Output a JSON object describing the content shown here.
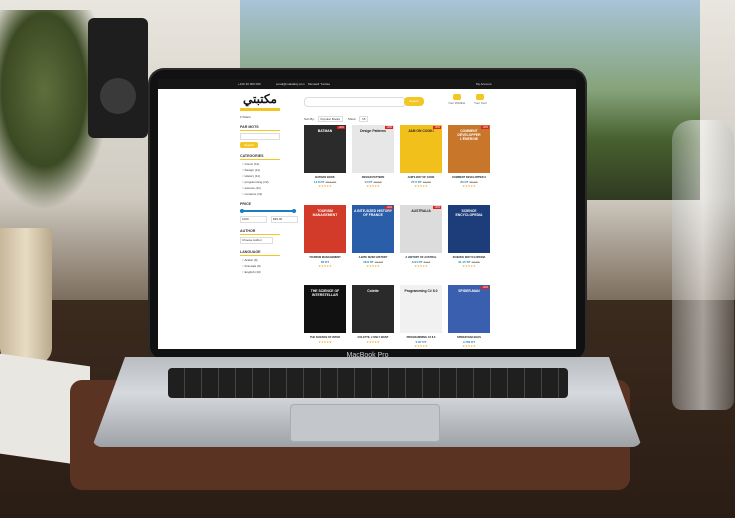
{
  "colors": {
    "accent": "#f3c623",
    "price": "#1a7fbf",
    "badge": "#e02020"
  },
  "laptop": {
    "brand": "MacBook Pro"
  },
  "site": {
    "topbar": {
      "phone": "+216 20 000 000",
      "email": "email@maktabty.com",
      "location": "Monastir Tunisia",
      "account": "My Account"
    },
    "logo": "مكتبتي",
    "search": {
      "placeholder": "",
      "button": "Search"
    },
    "header_icons": {
      "wishlist": "Your Wishlist",
      "cart": "Your Cart"
    },
    "sidebar": {
      "filters_label": "≡ Filters",
      "keywords_heading": "PAR MOTS",
      "keywords_placeholder": "",
      "keywords_button": "Search",
      "categories_heading": "CATEGORIES",
      "categories": [
        {
          "label": "Comic (12)"
        },
        {
          "label": "Design (11)"
        },
        {
          "label": "History (11)"
        },
        {
          "label": "programming (12)"
        },
        {
          "label": "science (11)"
        },
        {
          "label": "romance (11)"
        }
      ],
      "price_heading": "PRICE",
      "price_min": "1000",
      "price_max": "$99.00",
      "author_heading": "AUTHOR",
      "author_select": "Choose Author",
      "language_heading": "LANGUAGE",
      "languages": [
        {
          "label": "Arabic (9)"
        },
        {
          "label": "Francais (9)"
        },
        {
          "label": "English (10)"
        }
      ]
    },
    "sort": {
      "label": "Sort By:",
      "value": "Popular Books",
      "show_label": "Show:",
      "show_value": "15"
    },
    "products": [
      {
        "title": "BATMAN BOOK",
        "price": "14.8 DT",
        "old": "18.5 DT",
        "cover_color": "#2b2b2b",
        "cover_text": "BATMAN",
        "sale": true
      },
      {
        "title": "DESIGN PATTERN",
        "price": "14 DT",
        "old": "18 DT",
        "cover_color": "#e7e7e7",
        "cover_text": "Design Patterns",
        "sale": true
      },
      {
        "title": "JAM'S WAY OF COOK",
        "price": "27.6 DT",
        "old": "32 DT",
        "cover_color": "#f2c01a",
        "cover_text": "JAM ON COOK!",
        "sale": true
      },
      {
        "title": "COMMENT DEVELOPPER A",
        "price": "80 DT",
        "old": "95 DT",
        "cover_color": "#c7762a",
        "cover_text": "COMMENT DÉVELOPPER L'ÉNERGIE",
        "sale": true
      },
      {
        "title": "TOURISM MANAGEMENT",
        "price": "80 DT",
        "old": "",
        "cover_color": "#d23a2a",
        "cover_text": "TOURISM MANAGEMENT",
        "sale": false
      },
      {
        "title": "A BITE SIZED HISTORY",
        "price": "18.8 DT",
        "old": "22 DT",
        "cover_color": "#2b5ea8",
        "cover_text": "A BITE-SIZED HISTORY OF FRANCE",
        "sale": true
      },
      {
        "title": "A HISTORY OF AUSTRAL",
        "price": "6.94 DT",
        "old": "8 DT",
        "cover_color": "#dcdcdc",
        "cover_text": "AUSTRALIA",
        "sale": true
      },
      {
        "title": "SCIENCE ENCYCLOPEDIA",
        "price": "31.15 DT",
        "old": "37 DT",
        "cover_color": "#1d3d7a",
        "cover_text": "SCIENCE ENCYCLOPEDIA",
        "sale": false
      },
      {
        "title": "THE SCIENCE OF INTER",
        "price": "",
        "old": "",
        "cover_color": "#111111",
        "cover_text": "THE SCIENCE OF INTERSTELLAR",
        "sale": false
      },
      {
        "title": "COLETTE, L'ONLY WANT",
        "price": "",
        "old": "",
        "cover_color": "#2a2a2a",
        "cover_text": "Colette",
        "sale": false
      },
      {
        "title": "PROGRAMMING C# 8.0",
        "price": "5.87 DT",
        "old": "",
        "cover_color": "#f1f1f1",
        "cover_text": "Programming C# 8.0",
        "sale": false
      },
      {
        "title": "SPIDER MAN BLES",
        "price": "4.783 DT",
        "old": "",
        "cover_color": "#3a5fae",
        "cover_text": "SPIDER-MAN",
        "sale": true
      }
    ],
    "sale_badge": "-20%"
  }
}
